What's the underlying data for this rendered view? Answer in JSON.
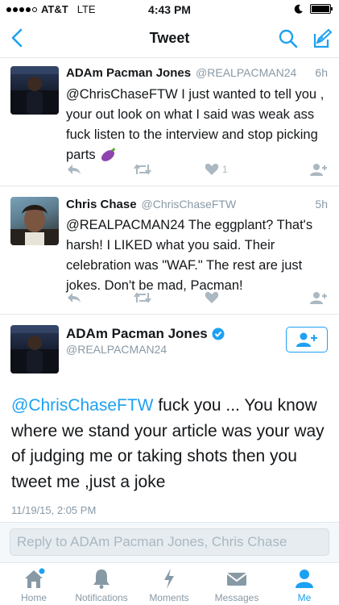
{
  "status_bar": {
    "carrier": "AT&T",
    "network": "LTE",
    "time": "4:43 PM"
  },
  "nav": {
    "title": "Tweet",
    "back_icon": "chevron-left-icon",
    "search_icon": "search-icon",
    "compose_icon": "compose-icon"
  },
  "colors": {
    "accent": "#1da1f2",
    "muted": "#8899a6",
    "eggplant": "#8e44ad"
  },
  "tweets": [
    {
      "name": "ADAm Pacman Jones",
      "handle": "@REALPACMAN24",
      "time": "6h",
      "text": "@ChrisChaseFTW I just wanted to tell you , your out look on what I said was weak ass fuck listen to the interview and stop picking parts",
      "emoji": "eggplant-emoji",
      "likes": "1"
    },
    {
      "name": "Chris Chase",
      "handle": "@ChrisChaseFTW",
      "time": "5h",
      "text": "@REALPACMAN24 The eggplant? That's harsh! I LIKED what you said. Their celebration was \"WAF.\" The rest are just jokes. Don't be mad, Pacman!",
      "likes": ""
    }
  ],
  "detail": {
    "name": "ADAm Pacman Jones",
    "handle": "@REALPACMAN24",
    "verified": true,
    "mention": "@ChrisChaseFTW",
    "text": " fuck you ... You know where we stand your article was your way of judging me or taking shots then you tweet me ,just a joke",
    "timestamp": "11/19/15, 2:05 PM"
  },
  "reply": {
    "placeholder": "Reply to ADAm Pacman Jones, Chris Chase"
  },
  "tabs": [
    {
      "label": "Home",
      "icon": "home-icon",
      "active": false
    },
    {
      "label": "Notifications",
      "icon": "bell-icon",
      "active": false
    },
    {
      "label": "Moments",
      "icon": "lightning-icon",
      "active": false
    },
    {
      "label": "Messages",
      "icon": "envelope-icon",
      "active": false
    },
    {
      "label": "Me",
      "icon": "person-icon",
      "active": true
    }
  ]
}
